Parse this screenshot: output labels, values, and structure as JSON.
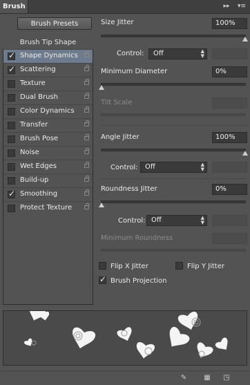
{
  "panel": {
    "title": "Brush"
  },
  "presets_button": "Brush Presets",
  "sidebar": {
    "header": "Brush Tip Shape",
    "items": [
      {
        "label": "Shape Dynamics",
        "checked": true,
        "active": true
      },
      {
        "label": "Scattering",
        "checked": true,
        "active": false
      },
      {
        "label": "Texture",
        "checked": false,
        "active": false
      },
      {
        "label": "Dual Brush",
        "checked": false,
        "active": false
      },
      {
        "label": "Color Dynamics",
        "checked": false,
        "active": false
      },
      {
        "label": "Transfer",
        "checked": false,
        "active": false
      },
      {
        "label": "Brush Pose",
        "checked": false,
        "active": false
      },
      {
        "label": "Noise",
        "checked": false,
        "active": false
      },
      {
        "label": "Wet Edges",
        "checked": false,
        "active": false
      },
      {
        "label": "Build-up",
        "checked": false,
        "active": false
      },
      {
        "label": "Smoothing",
        "checked": true,
        "active": false
      },
      {
        "label": "Protect Texture",
        "checked": false,
        "active": false
      }
    ]
  },
  "settings": {
    "size_jitter": {
      "label": "Size Jitter",
      "value": "100%",
      "level": 1.0
    },
    "size_control": {
      "label": "Control:",
      "value": "Off"
    },
    "min_diameter": {
      "label": "Minimum Diameter",
      "value": "0%",
      "level": 0.0
    },
    "tilt_scale": {
      "label": "Tilt Scale",
      "value": ""
    },
    "angle_jitter": {
      "label": "Angle Jitter",
      "value": "100%",
      "level": 1.0
    },
    "angle_control": {
      "label": "Control:",
      "value": "Off"
    },
    "roundness_jitter": {
      "label": "Roundness Jitter",
      "value": "0%",
      "level": 0.0
    },
    "roundness_control": {
      "label": "Control:",
      "value": "Off"
    },
    "min_roundness": {
      "label": "Minimum Roundness",
      "value": ""
    },
    "flip_x": {
      "label": "Flip X Jitter",
      "checked": false
    },
    "flip_y": {
      "label": "Flip Y Jitter",
      "checked": false
    },
    "brush_projection": {
      "label": "Brush Projection",
      "checked": true
    }
  },
  "icons": {
    "collapse": "double-arrow-icon",
    "menu": "panel-menu-icon",
    "toggle_hard_bristle": "bristle-preview-icon",
    "create_brush_grid": "grid-icon",
    "new_preset": "new-preset-icon"
  },
  "colors": {
    "panel_bg": "#535353",
    "active_row": "#6e7b8e",
    "field_bg": "#3a3a3a"
  }
}
